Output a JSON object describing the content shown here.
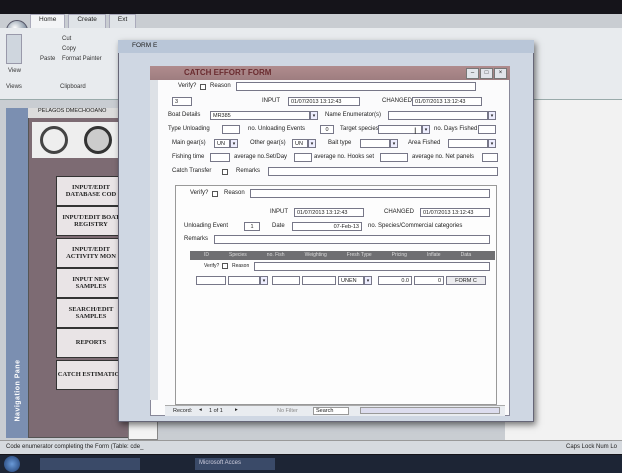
{
  "ribbon": {
    "tabs": [
      "Home",
      "Create",
      "Ext"
    ],
    "buttons": {
      "view": "View",
      "paste": "Paste",
      "cut": "Cut",
      "copy": "Copy",
      "format_painter": "Format Painter"
    },
    "groups": {
      "views": "Views",
      "clipboard": "Clipboard"
    }
  },
  "nav_pane": {
    "label": "Navigation Pane"
  },
  "menu_form": {
    "header": "PELAGOS DMECHOOANO",
    "buttons": [
      "INPUT/EDIT DATABASE COD",
      "INPUT/EDIT BOAT REGISTRY",
      "INPUT/EDIT ACTIVITY MON",
      "INPUT NEW SAMPLES",
      "SEARCH/EDIT SAMPLES",
      "REPORTS",
      "CATCH ESTIMATION"
    ]
  },
  "form": {
    "window_title": "FORM E",
    "banner": "CATCH EFFORT FORM",
    "verify_label": "Verify?",
    "reason_label": "Reason",
    "record_id": "3",
    "input_label": "INPUT",
    "input_value": "01/07/2013 13:12:43",
    "changed_label": "CHANGED",
    "changed_value": "01/07/2013 13:12:43",
    "boat_details_label": "Boat Details",
    "boat_details_value": "MR385",
    "name_enumerators_label": "Name Enumerator(s)",
    "type_unloading_label": "Type Unloading",
    "no_unloading_events_label": "no. Unloading Events",
    "no_unloading_events_value": "0",
    "target_species_label": "Target species",
    "no_days_fished_label": "no. Days Fished",
    "main_gears_label": "Main gear(s)",
    "main_gears_value": "UN",
    "other_gears_label": "Other gear(s)",
    "other_gears_value": "UN",
    "bait_type_label": "Bait type",
    "area_fished_label": "Area Fished",
    "fishing_time_label": "Fishing time",
    "avg_sets_label": "average no.Set/Day",
    "avg_hooks_label": "average no. Hooks set",
    "avg_panels_label": "average no. Net panels",
    "catch_transfer_label": "Catch Transfer",
    "remarks_label": "Remarks"
  },
  "subform": {
    "verify_label": "Verify?",
    "reason_label": "Reason",
    "input_label": "INPUT",
    "input_value": "01/07/2013 13:12:43",
    "changed_label": "CHANGED",
    "changed_value": "01/07/2013 13:12:43",
    "unloading_event_label": "Unloading Event",
    "unloading_event_value": "1",
    "date_label": "Date",
    "date_value": "07-Feb-13",
    "species_categories_label": "no. Species/Commercial categories",
    "remarks_label": "Remarks",
    "columns": [
      "ID",
      "Species",
      "no. Fish",
      "Weighting",
      "Fresh Type",
      "Pricing",
      "Inflate",
      "Data"
    ],
    "row": {
      "verify_label": "Verify?",
      "reason_label": "Reason",
      "unit": "UNEN",
      "value_a": "0.0",
      "value_b": "0",
      "form_button": "FORM C"
    }
  },
  "record_nav": {
    "label": "Record:",
    "position": "1 of 1",
    "filter": "No Filter",
    "search": "Search"
  },
  "status_bar": {
    "left": "Code enumerator completing the Form (Table: cde_",
    "right": "Caps Lock   Num Lo"
  },
  "taskbar": {
    "item1": "",
    "item2": "Microsoft Acces"
  }
}
